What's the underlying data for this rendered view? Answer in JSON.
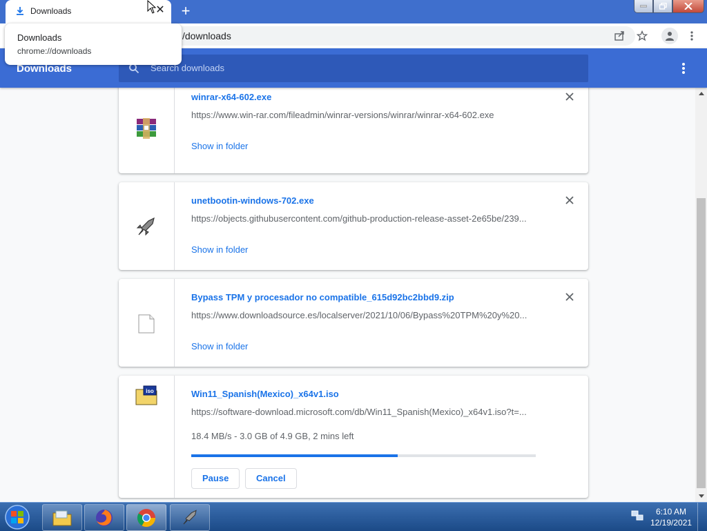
{
  "browser": {
    "tab": {
      "title": "Downloads",
      "icon": "download-icon"
    },
    "address": {
      "url_visible": "/downloads"
    },
    "tooltip": {
      "title": "Downloads",
      "url": "chrome://downloads"
    }
  },
  "downloads_page": {
    "title": "Downloads",
    "search": {
      "placeholder": "Search downloads"
    },
    "items": [
      {
        "filename": "winrar-x64-602.exe",
        "url": "https://www.win-rar.com/fileadmin/winrar-versions/winrar/winrar-x64-602.exe",
        "action": "Show in folder",
        "icon": "winrar-icon"
      },
      {
        "filename": "unetbootin-windows-702.exe",
        "url": "https://objects.githubusercontent.com/github-production-release-asset-2e65be/239...",
        "action": "Show in folder",
        "icon": "unetbootin-icon"
      },
      {
        "filename": "Bypass TPM y procesador no compatible_615d92bc2bbd9.zip",
        "url": "https://www.downloadsource.es/localserver/2021/10/06/Bypass%20TPM%20y%20...",
        "action": "Show in folder",
        "icon": "file-icon"
      },
      {
        "filename": "Win11_Spanish(Mexico)_x64v1.iso",
        "url": "https://software-download.microsoft.com/db/Win11_Spanish(Mexico)_x64v1.iso?t=...",
        "status": "18.4 MB/s - 3.0 GB of 4.9 GB, 2 mins left",
        "progress_percent": 60,
        "pause_label": "Pause",
        "cancel_label": "Cancel",
        "icon": "iso-icon"
      }
    ]
  },
  "taskbar": {
    "apps": [
      "explorer-icon",
      "firefox-icon",
      "chrome-icon",
      "unetbootin-icon"
    ],
    "clock": {
      "time": "6:10 AM",
      "date": "12/19/2021"
    }
  },
  "colors": {
    "header_blue": "#3b6cd4",
    "link_blue": "#1a73e8",
    "tab_strip": "#3f6fcd"
  }
}
